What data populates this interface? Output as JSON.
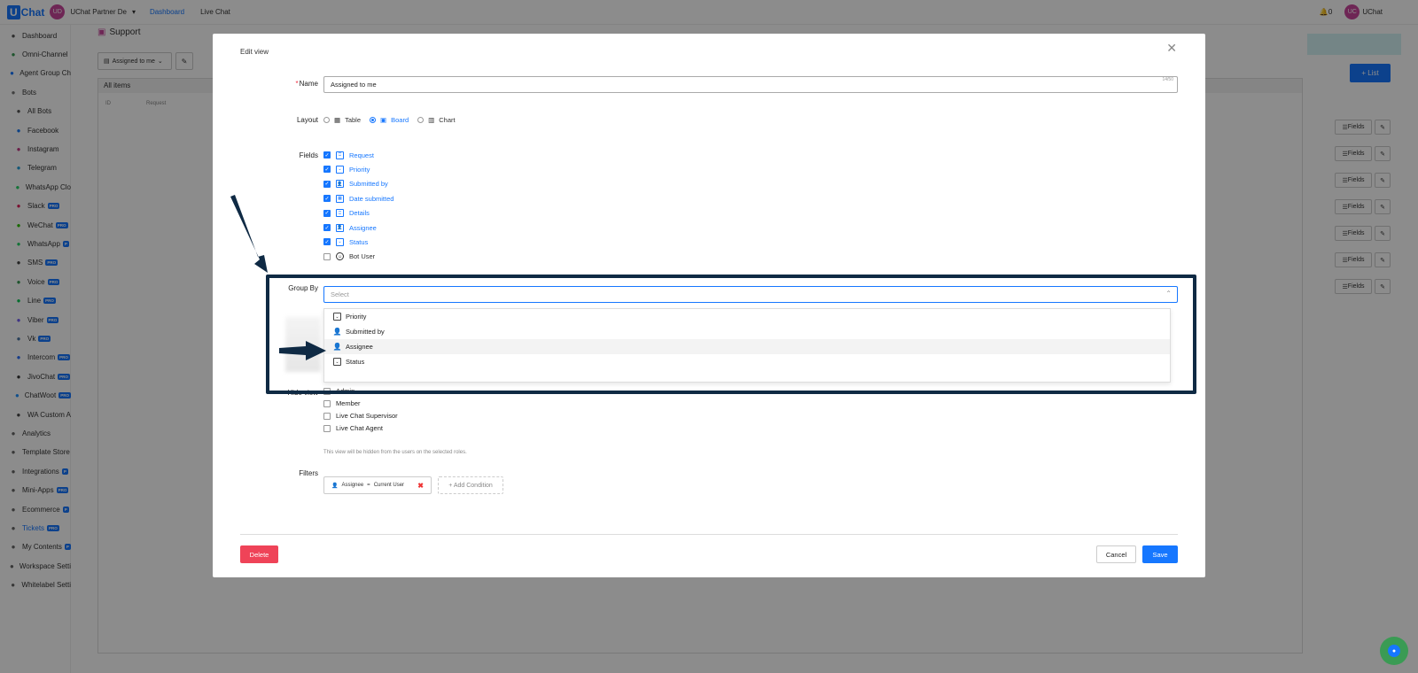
{
  "topbar": {
    "brand_u": "U",
    "brand_rest": "Chat",
    "org_avatar": "UD",
    "org_name": "UChat Partner De",
    "nav": [
      "Dashboard",
      "Live Chat"
    ],
    "notifications": "0",
    "user_avatar": "UC",
    "user_name": "UChat"
  },
  "sidebar": {
    "items": [
      {
        "label": "Dashboard",
        "icon": "dashboard-icon",
        "pro": ""
      },
      {
        "label": "Omni-Channel",
        "icon": "omni-icon",
        "pro": ""
      },
      {
        "label": "Agent Group Ch",
        "icon": "agent-icon",
        "pro": ""
      },
      {
        "label": "Bots",
        "icon": "bots-icon",
        "pro": ""
      },
      {
        "label": "All Bots",
        "icon": "allbots-icon",
        "pro": ""
      },
      {
        "label": "Facebook",
        "icon": "facebook-icon",
        "pro": ""
      },
      {
        "label": "Instagram",
        "icon": "instagram-icon",
        "pro": ""
      },
      {
        "label": "Telegram",
        "icon": "telegram-icon",
        "pro": ""
      },
      {
        "label": "WhatsApp Clo",
        "icon": "whatsapp-icon",
        "pro": ""
      },
      {
        "label": "Slack",
        "icon": "slack-icon",
        "pro": "PRO"
      },
      {
        "label": "WeChat",
        "icon": "wechat-icon",
        "pro": "PRO"
      },
      {
        "label": "WhatsApp",
        "icon": "whatsapp-icon",
        "pro": "P"
      },
      {
        "label": "SMS",
        "icon": "sms-icon",
        "pro": "PRO"
      },
      {
        "label": "Voice",
        "icon": "voice-icon",
        "pro": "PRO"
      },
      {
        "label": "Line",
        "icon": "line-icon",
        "pro": "PRO"
      },
      {
        "label": "Viber",
        "icon": "viber-icon",
        "pro": "PRO"
      },
      {
        "label": "Vk",
        "icon": "vk-icon",
        "pro": "PRO"
      },
      {
        "label": "Intercom",
        "icon": "intercom-icon",
        "pro": "PRO"
      },
      {
        "label": "JivoChat",
        "icon": "jivochat-icon",
        "pro": "PRO"
      },
      {
        "label": "ChatWoot",
        "icon": "chatwoot-icon",
        "pro": "PRO"
      },
      {
        "label": "WA Custom A",
        "icon": "wa-custom-icon",
        "pro": ""
      },
      {
        "label": "Analytics",
        "icon": "analytics-icon",
        "pro": ""
      },
      {
        "label": "Template Store",
        "icon": "template-icon",
        "pro": ""
      },
      {
        "label": "Integrations",
        "icon": "integrations-icon",
        "pro": "P"
      },
      {
        "label": "Mini-Apps",
        "icon": "miniapps-icon",
        "pro": "PRO"
      },
      {
        "label": "Ecommerce",
        "icon": "ecommerce-icon",
        "pro": "P"
      },
      {
        "label": "Tickets",
        "icon": "tickets-icon",
        "pro": "PRO"
      },
      {
        "label": "My Contents",
        "icon": "contents-icon",
        "pro": "P"
      },
      {
        "label": "Workspace Setti",
        "icon": "workspace-icon",
        "pro": ""
      },
      {
        "label": "Whitelabel Setti",
        "icon": "whitelabel-icon",
        "pro": ""
      }
    ]
  },
  "page": {
    "title": "Support",
    "view_select": "Assigned to me",
    "all_items": "All items",
    "col_id": "ID",
    "col_request": "Request",
    "list_button": "+ List",
    "fields_button": "Fields"
  },
  "modal": {
    "title": "Edit view",
    "name_label": "Name",
    "name_value": "Assigned to me",
    "name_counter": "14/50",
    "layout_label": "Layout",
    "layout_options": [
      "Table",
      "Board",
      "Chart"
    ],
    "fields_label": "Fields",
    "fields": [
      "Request",
      "Priority",
      "Submitted by",
      "Date submitted",
      "Details",
      "Assignee",
      "Status",
      "Bot User"
    ],
    "group_by_label": "Group By",
    "group_by_placeholder": "Select",
    "group_by_options": [
      "Priority",
      "Submitted by",
      "Assignee",
      "Status"
    ],
    "hide_view_label": "Hide view",
    "hide_view_roles": [
      "Admin",
      "Member",
      "Live Chat Supervisor",
      "Live Chat Agent"
    ],
    "hide_view_hint": "This view will be hidden from the users on the selected roles.",
    "filters_label": "Filters",
    "filter_field": "Assignee",
    "filter_op": "=",
    "filter_value": "Current User",
    "add_condition": "+ Add Condition",
    "delete": "Delete",
    "cancel": "Cancel",
    "save": "Save"
  },
  "colors": {
    "accent": "#1677ff",
    "danger": "#ef4358",
    "annotation": "#0f2a44"
  }
}
